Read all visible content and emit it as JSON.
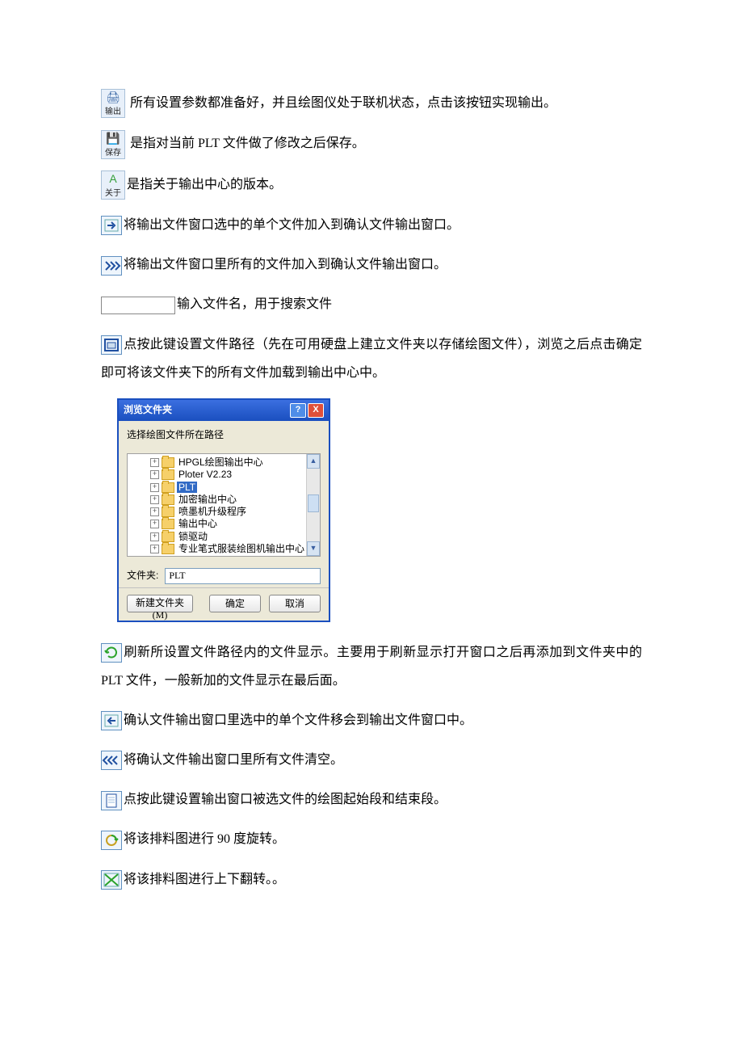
{
  "items": [
    {
      "kind": "iconbtn",
      "iconName": "printer-icon",
      "glyph": "🖨",
      "label": "输出",
      "text": " 所有设置参数都准备好，并且绘图仪处于联机状态，点击该按钮实现输出。"
    },
    {
      "kind": "iconbtn",
      "iconName": "save-icon",
      "glyph": "💾",
      "label": "保存",
      "text": " 是指对当前 PLT 文件做了修改之后保存。"
    },
    {
      "kind": "iconbtn",
      "iconName": "about-icon",
      "glyph": "A",
      "glyphColor": "#35a03a",
      "label": "关于",
      "text": "是指关于输出中心的版本。"
    },
    {
      "kind": "iconsq",
      "iconName": "arrow-right-icon",
      "svg": "right",
      "text": "将输出文件窗口选中的单个文件加入到确认文件输出窗口。"
    },
    {
      "kind": "iconsq",
      "iconName": "arrow-right-all-icon",
      "svg": "rightall",
      "text": "将输出文件窗口里所有的文件加入到确认文件输出窗口。"
    },
    {
      "kind": "input",
      "text": "输入文件名，用于搜索文件"
    },
    {
      "kind": "iconsq",
      "iconName": "browse-folder-icon",
      "svg": "browse",
      "text": "点按此键设置文件路径（先在可用硬盘上建立文件夹以存储绘图文件），浏览之后点击确定即可将该文件夹下的所有文件加载到输出中心中。"
    }
  ],
  "dialog": {
    "title": "浏览文件夹",
    "helpGlyph": "?",
    "closeGlyph": "X",
    "instruction": "选择绘图文件所在路径",
    "folders": [
      "HPGL绘图输出中心",
      "Ploter V2.23",
      "PLT",
      "加密输出中心",
      "喷墨机升级程序",
      "输出中心",
      "锁驱动",
      "专业笔式服装绘图机输出中心"
    ],
    "selectedIndex": 2,
    "fieldLabel": "文件夹:",
    "fieldValue": "PLT",
    "buttons": {
      "newFolder": "新建文件夹(M)",
      "ok": "确定",
      "cancel": "取消"
    }
  },
  "items2": [
    {
      "kind": "iconsq",
      "iconName": "refresh-icon",
      "svg": "refresh",
      "accent": "#2aa32a",
      "text": "刷新所设置文件路径内的文件显示。主要用于刷新显示打开窗口之后再添加到文件夹中的 PLT 文件，一般新加的文件显示在最后面。"
    },
    {
      "kind": "iconsq",
      "iconName": "arrow-left-icon",
      "svg": "left",
      "text": "确认文件输出窗口里选中的单个文件移会到输出文件窗口中。"
    },
    {
      "kind": "iconsq",
      "iconName": "arrow-left-all-icon",
      "svg": "leftall",
      "text": "将确认文件输出窗口里所有文件清空。"
    },
    {
      "kind": "iconsq",
      "iconName": "segments-icon",
      "svg": "doc",
      "text": "点按此键设置输出窗口被选文件的绘图起始段和结束段。"
    },
    {
      "kind": "iconsq",
      "iconName": "rotate-90-icon",
      "svg": "rotate",
      "text": "将该排料图进行 90 度旋转。"
    },
    {
      "kind": "iconsq",
      "iconName": "flip-vertical-icon",
      "svg": "flip",
      "accent": "#2aa32a",
      "text": "将该排料图进行上下翻转。。"
    }
  ]
}
